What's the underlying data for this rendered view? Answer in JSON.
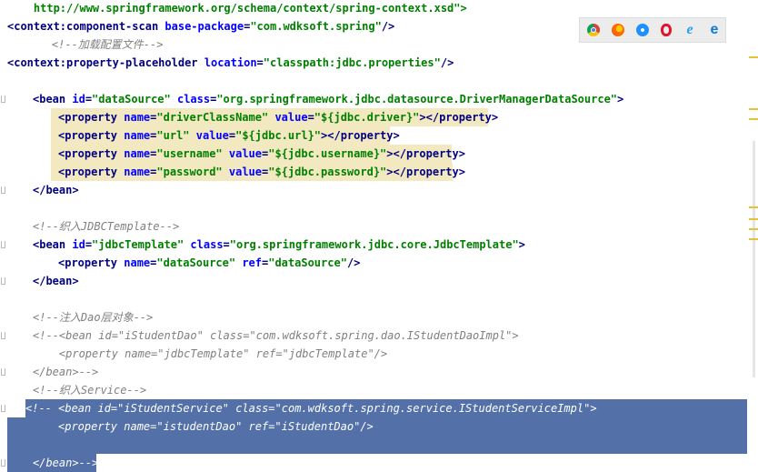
{
  "lines": [
    {
      "parts": [
        {
          "t": "    http://www.springframework.org/schema/context/spring-context.xsd\">",
          "c": "val"
        }
      ]
    },
    {
      "parts": [
        {
          "t": "<context:component-scan ",
          "c": "tag"
        },
        {
          "t": "base-package",
          "c": "attr"
        },
        {
          "t": "=",
          "c": "tag"
        },
        {
          "t": "\"com.wdksoft.spring\"",
          "c": "val"
        },
        {
          "t": "/>",
          "c": "tag"
        }
      ]
    },
    {
      "parts": [
        {
          "t": "    <!--加载配置文件-->",
          "c": "cm"
        }
      ]
    },
    {
      "parts": [
        {
          "t": "<context:property-placeholder ",
          "c": "tag"
        },
        {
          "t": "location",
          "c": "attr"
        },
        {
          "t": "=",
          "c": "tag"
        },
        {
          "t": "\"classpath:jdbc.properties\"",
          "c": "val"
        },
        {
          "t": "/>",
          "c": "tag"
        }
      ]
    },
    {
      "parts": []
    },
    {
      "parts": [
        {
          "t": "<bean ",
          "c": "tag"
        },
        {
          "t": "id",
          "c": "attr"
        },
        {
          "t": "=",
          "c": "tag"
        },
        {
          "t": "\"dataSource\" ",
          "c": "val"
        },
        {
          "t": "class",
          "c": "attr"
        },
        {
          "t": "=",
          "c": "tag"
        },
        {
          "t": "\"org.springframework.jdbc.datasource.DriverManagerDataSource\"",
          "c": "val"
        },
        {
          "t": ">",
          "c": "tag"
        }
      ]
    },
    {
      "parts": [
        {
          "t": "<property ",
          "c": "tag"
        },
        {
          "t": "name",
          "c": "attr"
        },
        {
          "t": "=",
          "c": "tag"
        },
        {
          "t": "\"driverClassName\" ",
          "c": "val"
        },
        {
          "t": "value",
          "c": "attr"
        },
        {
          "t": "=",
          "c": "tag"
        },
        {
          "t": "\"${jdbc.driver}\"",
          "c": "val"
        },
        {
          "t": "></property>",
          "c": "tag"
        }
      ]
    },
    {
      "parts": [
        {
          "t": "<property ",
          "c": "tag"
        },
        {
          "t": "name",
          "c": "attr"
        },
        {
          "t": "=",
          "c": "tag"
        },
        {
          "t": "\"url\" ",
          "c": "val"
        },
        {
          "t": "value",
          "c": "attr"
        },
        {
          "t": "=",
          "c": "tag"
        },
        {
          "t": "\"${jdbc.url}\"",
          "c": "val"
        },
        {
          "t": "></property>",
          "c": "tag"
        }
      ]
    },
    {
      "parts": [
        {
          "t": "<property ",
          "c": "tag"
        },
        {
          "t": "name",
          "c": "attr"
        },
        {
          "t": "=",
          "c": "tag"
        },
        {
          "t": "\"username\" ",
          "c": "val"
        },
        {
          "t": "value",
          "c": "attr"
        },
        {
          "t": "=",
          "c": "tag"
        },
        {
          "t": "\"${jdbc.username}\"",
          "c": "val"
        },
        {
          "t": "></property>",
          "c": "tag"
        }
      ]
    },
    {
      "parts": [
        {
          "t": "<property ",
          "c": "tag"
        },
        {
          "t": "name",
          "c": "attr"
        },
        {
          "t": "=",
          "c": "tag"
        },
        {
          "t": "\"password\" ",
          "c": "val"
        },
        {
          "t": "value",
          "c": "attr"
        },
        {
          "t": "=",
          "c": "tag"
        },
        {
          "t": "\"${jdbc.password}\"",
          "c": "val"
        },
        {
          "t": "></property>",
          "c": "tag"
        }
      ]
    },
    {
      "parts": [
        {
          "t": "</bean>",
          "c": "tag"
        }
      ]
    },
    {
      "parts": []
    },
    {
      "parts": [
        {
          "t": "<!--织入JDBCTemplate-->",
          "c": "cm"
        }
      ]
    },
    {
      "parts": [
        {
          "t": "<bean ",
          "c": "tag"
        },
        {
          "t": "id",
          "c": "attr"
        },
        {
          "t": "=",
          "c": "tag"
        },
        {
          "t": "\"jdbcTemplate\" ",
          "c": "val"
        },
        {
          "t": "class",
          "c": "attr"
        },
        {
          "t": "=",
          "c": "tag"
        },
        {
          "t": "\"org.springframework.jdbc.core.JdbcTemplate\"",
          "c": "val"
        },
        {
          "t": ">",
          "c": "tag"
        }
      ]
    },
    {
      "parts": [
        {
          "t": "<property ",
          "c": "tag"
        },
        {
          "t": "name",
          "c": "attr"
        },
        {
          "t": "=",
          "c": "tag"
        },
        {
          "t": "\"dataSource\" ",
          "c": "val"
        },
        {
          "t": "ref",
          "c": "attr"
        },
        {
          "t": "=",
          "c": "tag"
        },
        {
          "t": "\"dataSource\"",
          "c": "val"
        },
        {
          "t": "/>",
          "c": "tag"
        }
      ]
    },
    {
      "parts": [
        {
          "t": "</bean>",
          "c": "tag"
        }
      ]
    },
    {
      "parts": []
    },
    {
      "parts": [
        {
          "t": "<!--注入Dao层对象-->",
          "c": "cm"
        }
      ]
    },
    {
      "parts": [
        {
          "t": "<!--<bean id=\"iStudentDao\" class=\"com.wdksoft.spring.dao.IStudentDaoImpl\">",
          "c": "cm"
        }
      ]
    },
    {
      "parts": [
        {
          "t": "    <property name=\"jdbcTemplate\" ref=\"jdbcTemplate\"/>",
          "c": "cm"
        }
      ]
    },
    {
      "parts": [
        {
          "t": "</bean>-->",
          "c": "cm"
        }
      ]
    },
    {
      "parts": [
        {
          "t": "<!--织入Service-->",
          "c": "cm"
        }
      ]
    },
    {
      "parts": [
        {
          "t": "<!-- <bean id=\"iStudentService\" class=\"com.wdksoft.spring.service.IStudentServiceImpl\">",
          "c": "sel"
        }
      ]
    },
    {
      "parts": [
        {
          "t": "<property name=\"istudentDao\" ref=\"iStudentDao\"/>",
          "c": "sel"
        }
      ]
    },
    {
      "parts": []
    },
    {
      "parts": [
        {
          "t": "</bean>-->",
          "c": "sel"
        }
      ]
    }
  ],
  "browser_icons": [
    "chrome-icon",
    "firefox-icon",
    "safari-icon",
    "opera-icon",
    "ie-icon",
    "edge-icon"
  ],
  "colors": {
    "tag": "#000080",
    "attribute": "#0000ff",
    "value": "#008000",
    "comment": "#808080",
    "selection": "#5370a8",
    "highlight": "#f2e9c1"
  }
}
